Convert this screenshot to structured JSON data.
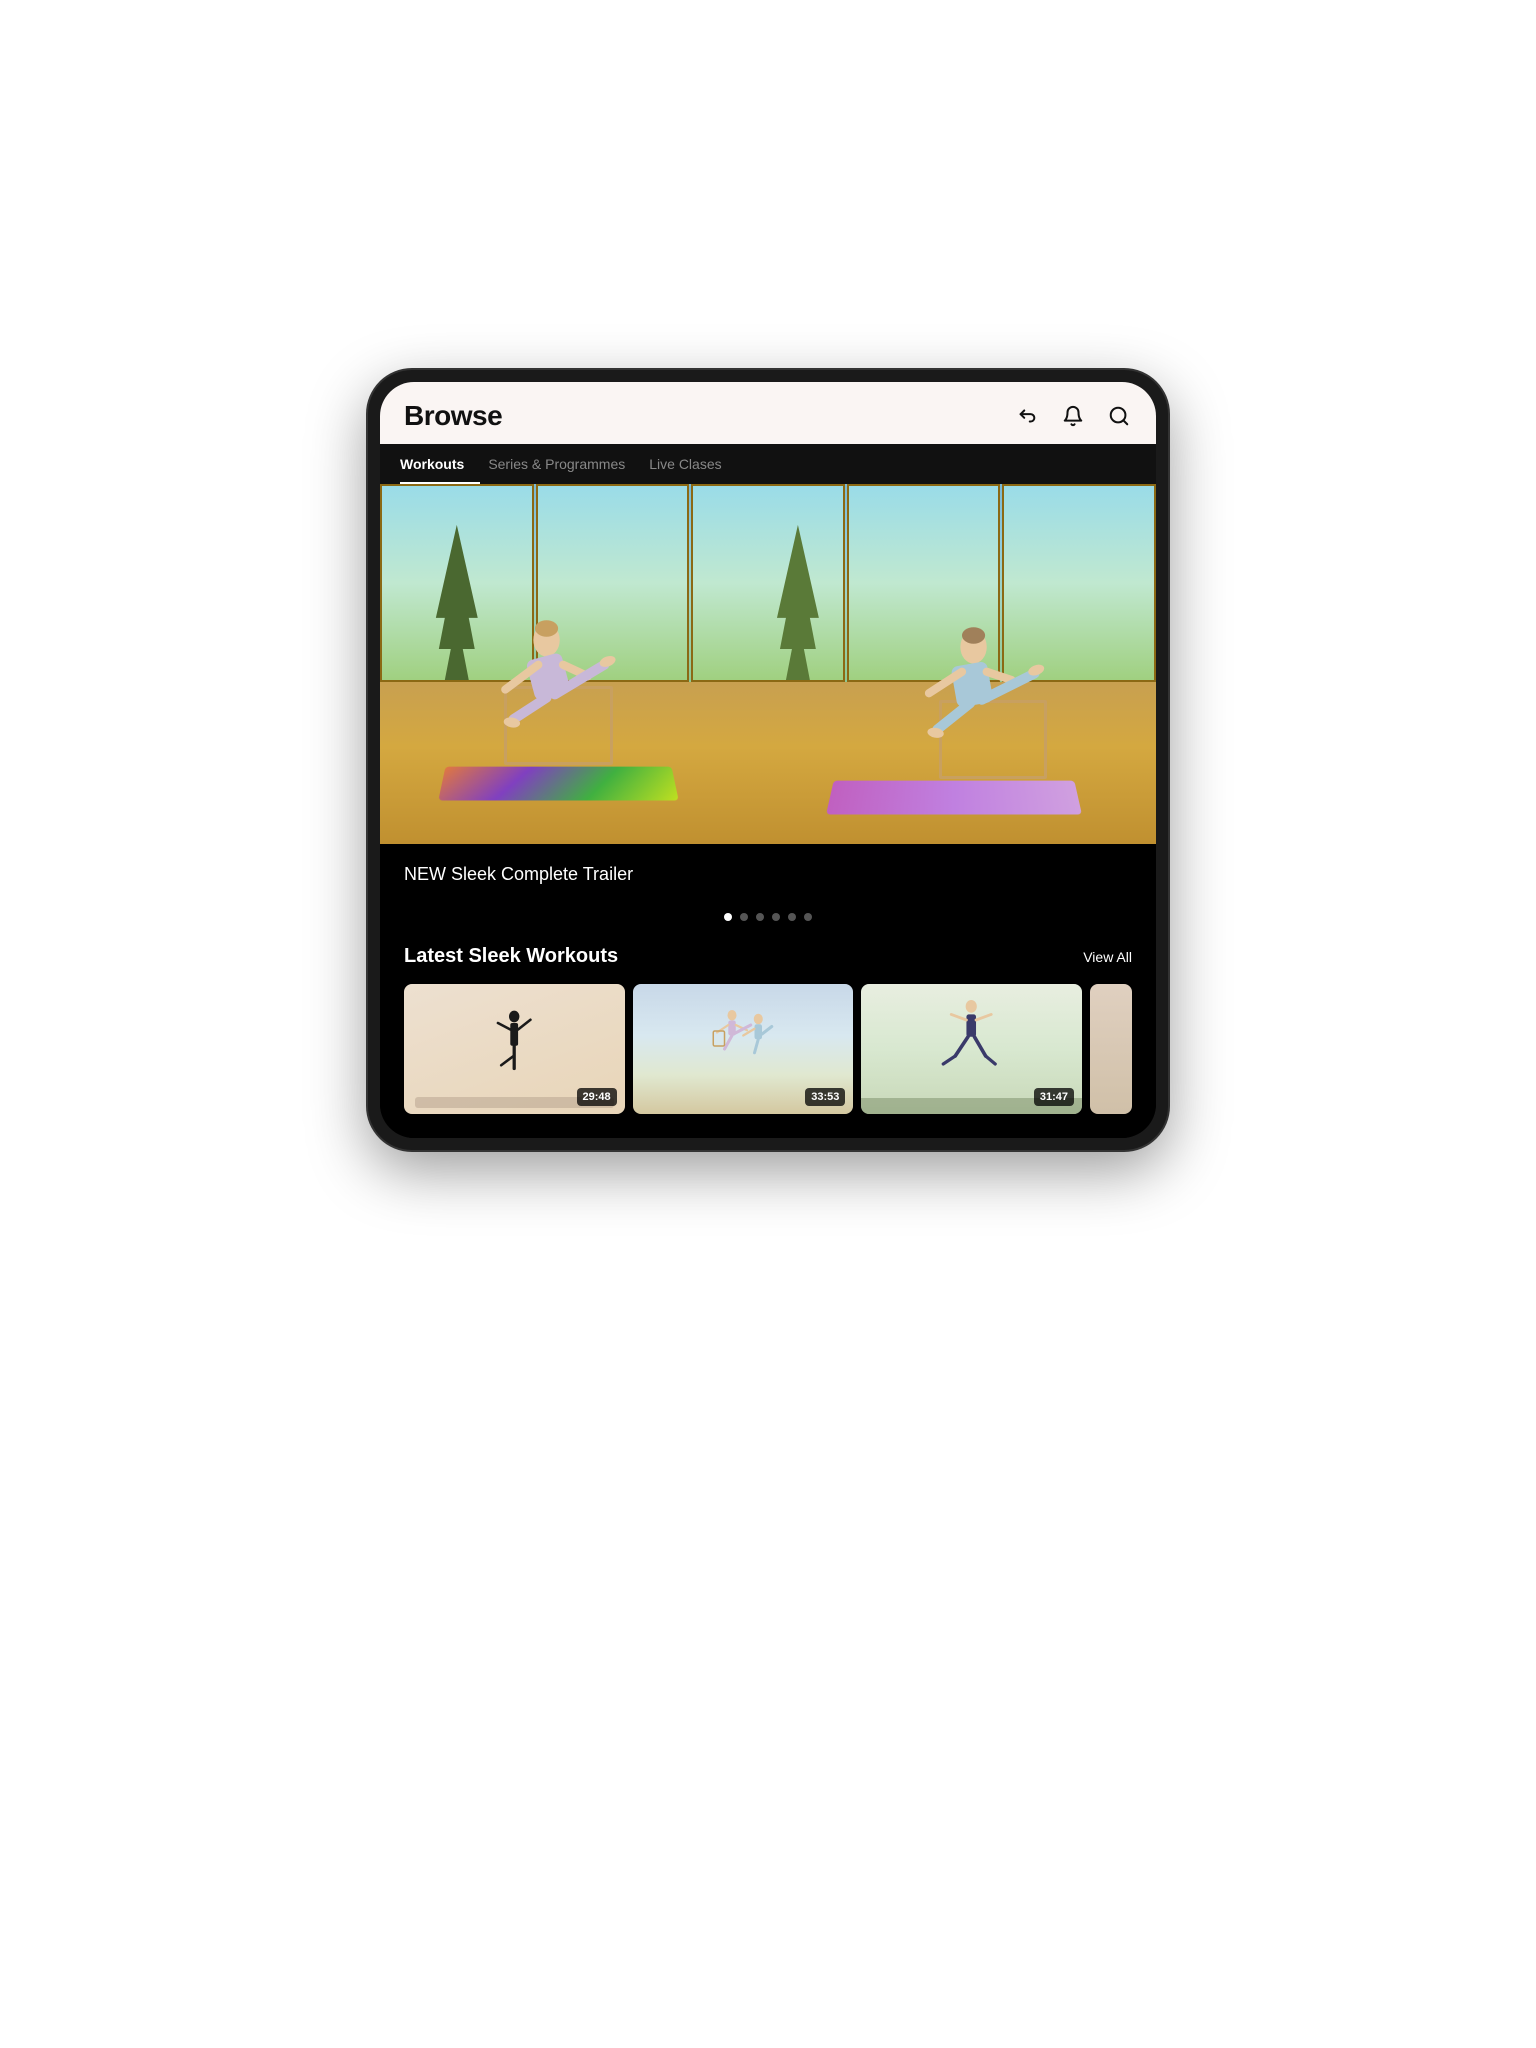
{
  "header": {
    "title": "Browse",
    "icons": {
      "back": "↩",
      "bell": "🔔",
      "search": "🔍"
    }
  },
  "nav": {
    "tabs": [
      {
        "label": "Workouts",
        "active": true
      },
      {
        "label": "Series & Programmes",
        "active": false
      },
      {
        "label": "Live Clases",
        "active": false
      }
    ]
  },
  "hero": {
    "title": "NEW Sleek Complete Trailer",
    "carousel_dots": [
      true,
      false,
      false,
      false,
      false,
      false
    ]
  },
  "latest_section": {
    "title": "Latest Sleek Workouts",
    "view_all_label": "View All",
    "workouts": [
      {
        "duration": "29:48"
      },
      {
        "duration": "33:53"
      },
      {
        "duration": "31:47"
      },
      {
        "duration": ""
      }
    ]
  }
}
